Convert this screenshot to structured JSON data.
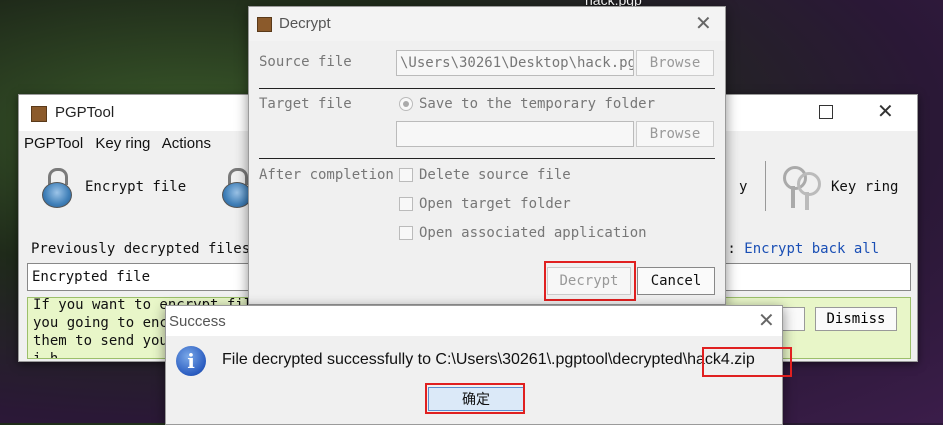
{
  "desktop": {
    "file_label": "hack.pgp"
  },
  "pgptool": {
    "title": "PGPTool",
    "menu": [
      "PGPTool",
      "Key ring",
      "Actions"
    ],
    "toolbar": {
      "encrypt_file": "Encrypt file",
      "partial_label": "y",
      "key_ring": "Key ring"
    },
    "prev_decrypted_label": "Previously decrypted files",
    "encrypt_back_all": {
      "prefix": "):",
      "link": "Encrypt back all"
    },
    "combo_value": "Encrypted file",
    "info_lines": [
      "If you want to encrypt files",
      "you going to encr",
      "them to send you",
      "i         h   "
    ],
    "dismiss_label": "Dismiss"
  },
  "decrypt_dialog": {
    "title": "Decrypt",
    "source_label": "Source file",
    "source_value": "\\Users\\30261\\Desktop\\hack.pgp",
    "browse_label": "Browse",
    "target_label": "Target file",
    "save_temp_label": "Save to the temporary folder",
    "target_value": "",
    "after_label": "After completion",
    "options": [
      "Delete source file",
      "Open target folder",
      "Open associated application"
    ],
    "decrypt_label": "Decrypt",
    "cancel_label": "Cancel"
  },
  "success_dialog": {
    "title": "Success",
    "message_prefix": "File decrypted successfully to C:\\Users\\30261\\.pgptool\\decrypted",
    "message_file": "\\hack4.zip",
    "ok_label": "确定"
  }
}
